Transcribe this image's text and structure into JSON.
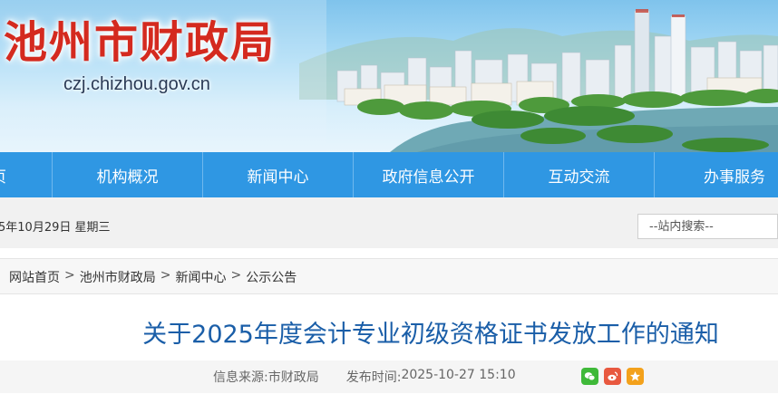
{
  "header": {
    "title": "池州市财政局",
    "domain": "czj.chizhou.gov.cn"
  },
  "nav": {
    "items": [
      {
        "label": "页"
      },
      {
        "label": "机构概况"
      },
      {
        "label": "新闻中心"
      },
      {
        "label": "政府信息公开"
      },
      {
        "label": "互动交流"
      },
      {
        "label": "办事服务"
      }
    ]
  },
  "infobar": {
    "date": "5年10月29日 星期三",
    "search_placeholder": "--站内搜索--"
  },
  "breadcrumb": {
    "items": [
      "网站首页",
      "池州市财政局",
      "新闻中心",
      "公示公告"
    ],
    "separator": ">"
  },
  "article": {
    "title": "关于2025年度会计专业初级资格证书发放工作的通知",
    "source_label": "信息来源:",
    "source": "市财政局",
    "time_label": "发布时间:",
    "time": "2025-10-27 15:10"
  },
  "share": {
    "icons": [
      "wechat-icon",
      "weibo-icon",
      "favorite-icon"
    ]
  },
  "colors": {
    "nav_bg": "#2f97e3",
    "title_red": "#d42a1f",
    "article_title_blue": "#1a5ea8"
  }
}
